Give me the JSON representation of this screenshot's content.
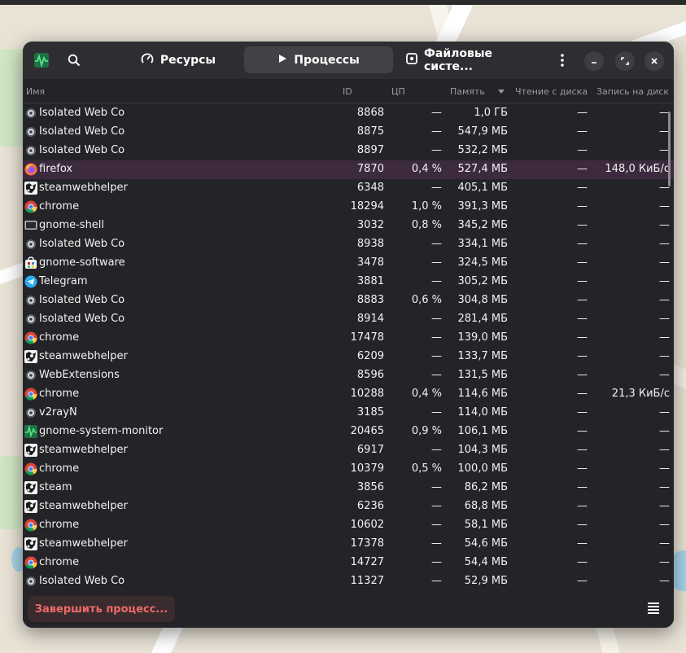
{
  "header": {
    "tabs": [
      {
        "label": "Ресурсы",
        "icon": "gauge-icon",
        "active": false
      },
      {
        "label": "Процессы",
        "icon": "play-icon",
        "active": true
      },
      {
        "label": "Файловые систе...",
        "icon": "drive-icon",
        "active": false
      }
    ]
  },
  "columns": {
    "name": "Имя",
    "id": "ID",
    "cpu": "ЦП",
    "memory": "Память",
    "disk_read": "Чтение с диска",
    "disk_write": "Запись на диск"
  },
  "processes": [
    {
      "name": "Isolated Web Co",
      "icon": "gear-icon",
      "id": "8868",
      "cpu": "—",
      "memory": "1,0 ГБ",
      "disk_read": "—",
      "disk_write": "—"
    },
    {
      "name": "Isolated Web Co",
      "icon": "gear-icon",
      "id": "8875",
      "cpu": "—",
      "memory": "547,9 МБ",
      "disk_read": "—",
      "disk_write": "—"
    },
    {
      "name": "Isolated Web Co",
      "icon": "gear-icon",
      "id": "8897",
      "cpu": "—",
      "memory": "532,2 МБ",
      "disk_read": "—",
      "disk_write": "—"
    },
    {
      "name": "firefox",
      "icon": "firefox-icon",
      "id": "7870",
      "cpu": "0,4 %",
      "memory": "527,4 МБ",
      "disk_read": "—",
      "disk_write": "148,0 КиБ/с",
      "selected": true
    },
    {
      "name": "steamwebhelper",
      "icon": "steam-icon",
      "id": "6348",
      "cpu": "—",
      "memory": "405,1 МБ",
      "disk_read": "—",
      "disk_write": "—"
    },
    {
      "name": "chrome",
      "icon": "chrome-icon",
      "id": "18294",
      "cpu": "1,0 %",
      "memory": "391,3 МБ",
      "disk_read": "—",
      "disk_write": "—"
    },
    {
      "name": "gnome-shell",
      "icon": "monitor-icon",
      "id": "3032",
      "cpu": "0,8 %",
      "memory": "345,2 МБ",
      "disk_read": "—",
      "disk_write": "—"
    },
    {
      "name": "Isolated Web Co",
      "icon": "gear-icon",
      "id": "8938",
      "cpu": "—",
      "memory": "334,1 МБ",
      "disk_read": "—",
      "disk_write": "—"
    },
    {
      "name": "gnome-software",
      "icon": "software-icon",
      "id": "3478",
      "cpu": "—",
      "memory": "324,5 МБ",
      "disk_read": "—",
      "disk_write": "—"
    },
    {
      "name": "Telegram",
      "icon": "telegram-icon",
      "id": "3881",
      "cpu": "—",
      "memory": "305,2 МБ",
      "disk_read": "—",
      "disk_write": "—"
    },
    {
      "name": "Isolated Web Co",
      "icon": "gear-icon",
      "id": "8883",
      "cpu": "0,6 %",
      "memory": "304,8 МБ",
      "disk_read": "—",
      "disk_write": "—"
    },
    {
      "name": "Isolated Web Co",
      "icon": "gear-icon",
      "id": "8914",
      "cpu": "—",
      "memory": "281,4 МБ",
      "disk_read": "—",
      "disk_write": "—"
    },
    {
      "name": "chrome",
      "icon": "chrome-icon",
      "id": "17478",
      "cpu": "—",
      "memory": "139,0 МБ",
      "disk_read": "—",
      "disk_write": "—"
    },
    {
      "name": "steamwebhelper",
      "icon": "steam-icon",
      "id": "6209",
      "cpu": "—",
      "memory": "133,7 МБ",
      "disk_read": "—",
      "disk_write": "—"
    },
    {
      "name": "WebExtensions",
      "icon": "gear-icon",
      "id": "8596",
      "cpu": "—",
      "memory": "131,5 МБ",
      "disk_read": "—",
      "disk_write": "—"
    },
    {
      "name": "chrome",
      "icon": "chrome-icon",
      "id": "10288",
      "cpu": "0,4 %",
      "memory": "114,6 МБ",
      "disk_read": "—",
      "disk_write": "21,3 КиБ/с"
    },
    {
      "name": "v2rayN",
      "icon": "gear-icon",
      "id": "3185",
      "cpu": "—",
      "memory": "114,0 МБ",
      "disk_read": "—",
      "disk_write": "—"
    },
    {
      "name": "gnome-system-monitor",
      "icon": "system-monitor-icon",
      "id": "20465",
      "cpu": "0,9 %",
      "memory": "106,1 МБ",
      "disk_read": "—",
      "disk_write": "—"
    },
    {
      "name": "steamwebhelper",
      "icon": "steam-icon",
      "id": "6917",
      "cpu": "—",
      "memory": "104,3 МБ",
      "disk_read": "—",
      "disk_write": "—"
    },
    {
      "name": "chrome",
      "icon": "chrome-icon",
      "id": "10379",
      "cpu": "0,5 %",
      "memory": "100,0 МБ",
      "disk_read": "—",
      "disk_write": "—"
    },
    {
      "name": "steam",
      "icon": "steam-icon",
      "id": "3856",
      "cpu": "—",
      "memory": "86,2 МБ",
      "disk_read": "—",
      "disk_write": "—"
    },
    {
      "name": "steamwebhelper",
      "icon": "steam-icon",
      "id": "6236",
      "cpu": "—",
      "memory": "68,8 МБ",
      "disk_read": "—",
      "disk_write": "—"
    },
    {
      "name": "chrome",
      "icon": "chrome-icon",
      "id": "10602",
      "cpu": "—",
      "memory": "58,1 МБ",
      "disk_read": "—",
      "disk_write": "—"
    },
    {
      "name": "steamwebhelper",
      "icon": "steam-icon",
      "id": "17378",
      "cpu": "—",
      "memory": "54,6 МБ",
      "disk_read": "—",
      "disk_write": "—"
    },
    {
      "name": "chrome",
      "icon": "chrome-icon",
      "id": "14727",
      "cpu": "—",
      "memory": "54,4 МБ",
      "disk_read": "—",
      "disk_write": "—"
    },
    {
      "name": "Isolated Web Co",
      "icon": "gear-icon",
      "id": "11327",
      "cpu": "—",
      "memory": "52,9 МБ",
      "disk_read": "—",
      "disk_write": "—"
    }
  ],
  "footer": {
    "end_process_label": "Завершить процесс..."
  },
  "colors": {
    "window_bg": "#242428",
    "selected_row": "#3d2a3e",
    "destructive_text": "#ee6a6a",
    "accent_green": "#2ec27e"
  }
}
